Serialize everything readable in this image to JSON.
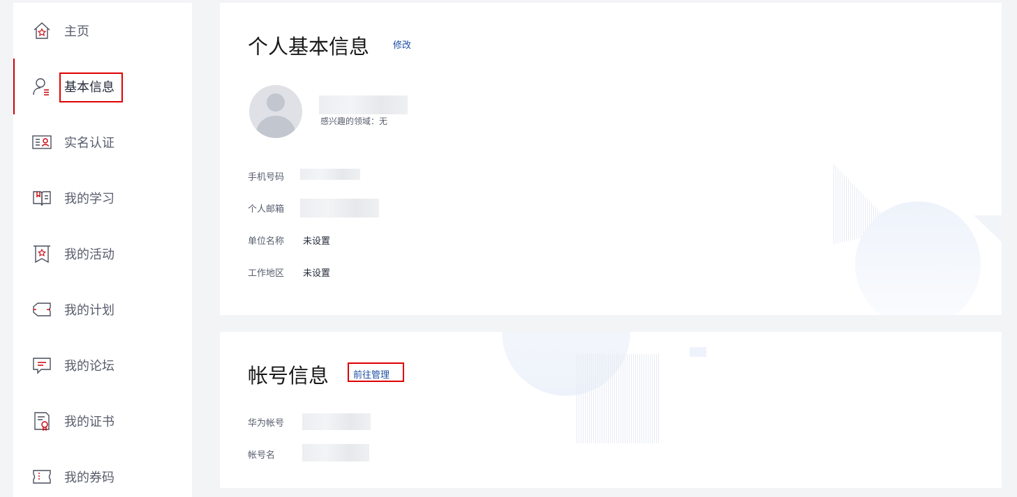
{
  "sidebar": {
    "items": [
      {
        "label": "主页",
        "icon": "home-star-icon"
      },
      {
        "label": "基本信息",
        "icon": "user-profile-icon"
      },
      {
        "label": "实名认证",
        "icon": "id-card-icon"
      },
      {
        "label": "我的学习",
        "icon": "open-book-icon"
      },
      {
        "label": "我的活动",
        "icon": "banner-star-icon"
      },
      {
        "label": "我的计划",
        "icon": "ticket-plan-icon"
      },
      {
        "label": "我的论坛",
        "icon": "chat-bubble-icon"
      },
      {
        "label": "我的证书",
        "icon": "certificate-icon"
      },
      {
        "label": "我的券码",
        "icon": "coupon-icon"
      }
    ],
    "active_index": 1
  },
  "profile": {
    "title": "个人基本信息",
    "edit_label": "修改",
    "interest_label": "感兴趣的领域：无",
    "fields": [
      {
        "label": "手机号码",
        "value": ""
      },
      {
        "label": "个人邮箱",
        "value": ""
      },
      {
        "label": "单位名称",
        "value": "未设置"
      },
      {
        "label": "工作地区",
        "value": "未设置"
      }
    ]
  },
  "account": {
    "title": "帐号信息",
    "manage_label": "前往管理",
    "fields": [
      {
        "label": "华为帐号",
        "value": ""
      },
      {
        "label": "帐号名",
        "value": ""
      }
    ]
  },
  "colors": {
    "accent": "#c7000b",
    "link": "#1a4ea3",
    "highlight": "#e00000",
    "background": "#f3f4f6"
  }
}
